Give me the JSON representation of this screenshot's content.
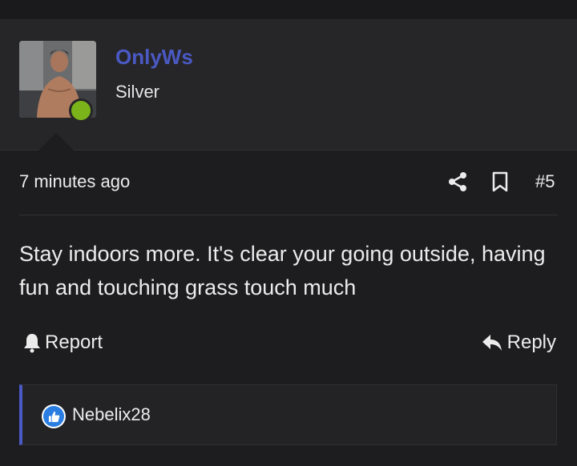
{
  "post": {
    "username": "OnlyWs",
    "rank": "Silver",
    "time": "7 minutes ago",
    "number": "#5",
    "body": "Stay indoors more. It's clear your going outside, having fun and touching grass touch much"
  },
  "actions": {
    "report_label": "Report",
    "reply_label": "Reply"
  },
  "reactions": {
    "user": "Nebelix28",
    "icon": "like-icon"
  },
  "colors": {
    "username": "#4a59c4",
    "online": "#7bb31a",
    "like": "#2a7de1"
  }
}
